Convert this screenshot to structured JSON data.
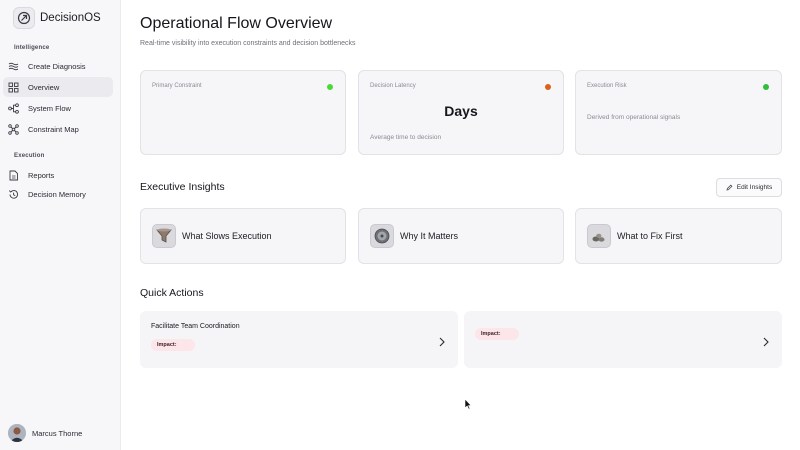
{
  "app": {
    "name": "DecisionOS"
  },
  "sidebar": {
    "sections": [
      {
        "label": "Intelligence"
      },
      {
        "label": "Execution"
      }
    ],
    "items": [
      {
        "label": "Create Diagnosis",
        "icon": "sliders-icon"
      },
      {
        "label": "Overview",
        "icon": "grid-icon",
        "active": true
      },
      {
        "label": "System Flow",
        "icon": "flow-icon"
      },
      {
        "label": "Constraint Map",
        "icon": "network-icon"
      },
      {
        "label": "Reports",
        "icon": "document-icon"
      },
      {
        "label": "Decision Memory",
        "icon": "history-icon"
      }
    ],
    "user": {
      "name": "Marcus Thorne"
    }
  },
  "header": {
    "title": "Operational Flow Overview",
    "subtitle": "Real-time visibility into execution constraints and decision bottlenecks"
  },
  "metrics": [
    {
      "label": "Primary Constraint",
      "value": "",
      "caption": "",
      "status_color": "#4cd83a"
    },
    {
      "label": "Decision Latency",
      "value": "Days",
      "caption": "Average time to decision",
      "status_color": "#d9621c"
    },
    {
      "label": "Execution Risk",
      "value": "",
      "caption": "Derived from operational signals",
      "status_color": "#2fbf3a"
    }
  ],
  "insights": {
    "title": "Executive Insights",
    "edit_label": "Edit Insights",
    "items": [
      {
        "label": "What Slows Execution",
        "icon": "funnel-icon"
      },
      {
        "label": "Why It Matters",
        "icon": "gauge-icon"
      },
      {
        "label": "What to Fix First",
        "icon": "stones-icon"
      }
    ]
  },
  "quick_actions": {
    "title": "Quick Actions",
    "items": [
      {
        "title": "Facilitate Team Coordination",
        "impact_label": "Impact:"
      },
      {
        "title": "",
        "impact_label": "Impact:"
      }
    ]
  }
}
